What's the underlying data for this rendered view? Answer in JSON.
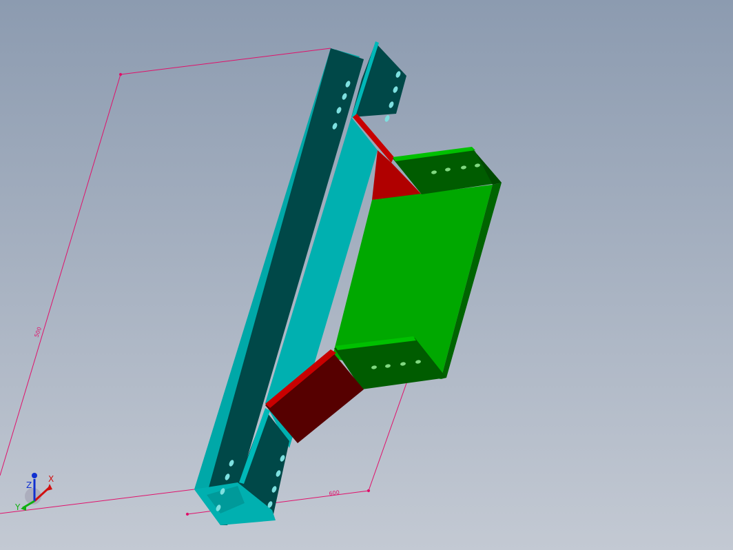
{
  "viewport": {
    "background_top": "#8c9bb0",
    "background_bottom": "#c3c9d3"
  },
  "model": {
    "colors": {
      "main_tray_dark": "#004848",
      "main_tray_light": "#00b0b0",
      "branch_tray_face": "#00a800",
      "branch_tray_dark": "#005c00",
      "reducer_face": "#560000",
      "reducer_light": "#c80000"
    }
  },
  "sketch": {
    "color": "#e0106a",
    "dimension_labels": [
      "500",
      "600"
    ]
  },
  "triad": {
    "labels": {
      "x": "X",
      "y": "Y",
      "z": "Z"
    },
    "colors": {
      "x": "#d01010",
      "y": "#10b010",
      "z": "#1030d0"
    }
  }
}
